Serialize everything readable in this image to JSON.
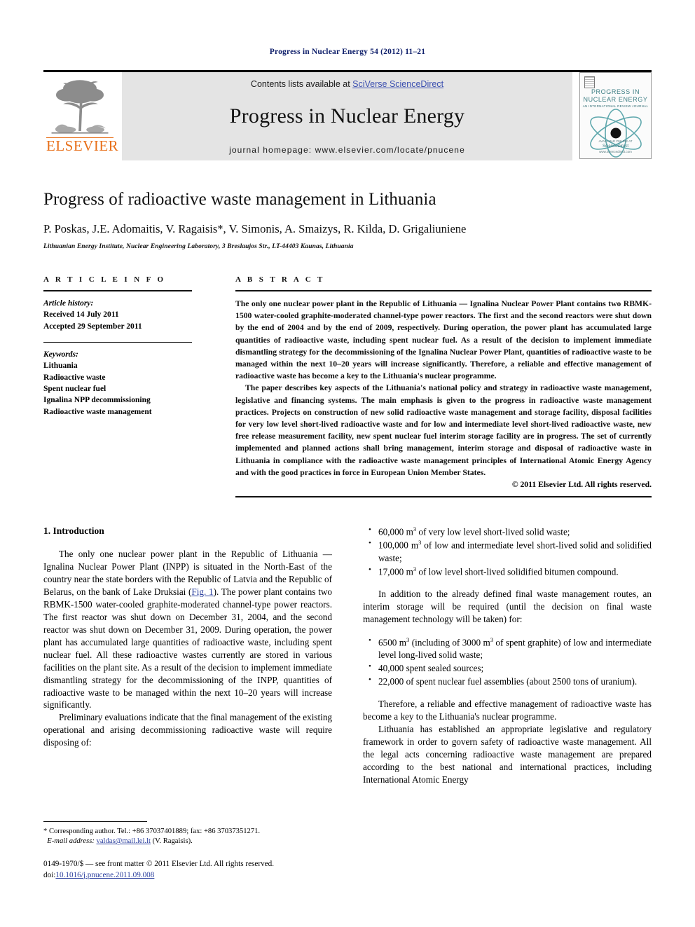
{
  "running_head": "Progress in Nuclear Energy 54 (2012) 11–21",
  "masthead": {
    "publisher_name": "ELSEVIER",
    "contents_prefix": "Contents lists available at ",
    "sciencedirect_link": "SciVerse ScienceDirect",
    "journal_title": "Progress in Nuclear Energy",
    "homepage_line": "journal homepage: www.elsevier.com/locate/pnucene",
    "cover": {
      "line1": "PROGRESS IN",
      "line2": "NUCLEAR ENERGY",
      "subtitle": "AN INTERNATIONAL REVIEW JOURNAL",
      "footer_small": "AVAILABLE ONLINE AT",
      "footer_big": "ScienceDirect",
      "footer_url": "www.sciencedirect.com"
    },
    "accent_orange": "#e8701a",
    "link_blue": "#3b4fb0",
    "band_gray": "#e4e4e4",
    "cover_teal": "#3f7f85"
  },
  "article": {
    "title": "Progress of radioactive waste management in Lithuania",
    "authors": "P. Poskas, J.E. Adomaitis, V. Ragaisis*, V. Simonis, A. Smaizys, R. Kilda, D. Grigaliuniene",
    "affiliation": "Lithuanian Energy Institute, Nuclear Engineering Laboratory, 3 Breslaujos Str., LT-44403 Kaunas, Lithuania"
  },
  "article_info": {
    "heading": "A R T I C L E   I N F O",
    "history_label": "Article history:",
    "received": "Received 14 July 2011",
    "accepted": "Accepted 29 September 2011",
    "keywords_label": "Keywords:",
    "keywords": [
      "Lithuania",
      "Radioactive waste",
      "Spent nuclear fuel",
      "Ignalina NPP decommissioning",
      "Radioactive waste management"
    ]
  },
  "abstract": {
    "heading": "A B S T R A C T",
    "paragraph1": "The only one nuclear power plant in the Republic of Lithuania — Ignalina Nuclear Power Plant contains two RBMK-1500 water-cooled graphite-moderated channel-type power reactors. The first and the second reactors were shut down by the end of 2004 and by the end of 2009, respectively. During operation, the power plant has accumulated large quantities of radioactive waste, including spent nuclear fuel. As a result of the decision to implement immediate dismantling strategy for the decommissioning of the Ignalina Nuclear Power Plant, quantities of radioactive waste to be managed within the next 10–20 years will increase significantly. Therefore, a reliable and effective management of radioactive waste has become a key to the Lithuania's nuclear programme.",
    "paragraph2": "The paper describes key aspects of the Lithuania's national policy and strategy in radioactive waste management, legislative and financing systems. The main emphasis is given to the progress in radioactive waste management practices. Projects on construction of new solid radioactive waste management and storage facility, disposal facilities for very low level short-lived radioactive waste and for low and intermediate level short-lived radioactive waste, new free release measurement facility, new spent nuclear fuel interim storage facility are in progress. The set of currently implemented and planned actions shall bring management, interim storage and disposal of radioactive waste in Lithuania in compliance with the radioactive waste management principles of International Atomic Energy Agency and with the good practices in force in European Union Member States.",
    "copyright": "© 2011 Elsevier Ltd. All rights reserved."
  },
  "body": {
    "section_number_title": "1. Introduction",
    "left_para1_a": "The only one nuclear power plant in the Republic of Lithuania — Ignalina Nuclear Power Plant (INPP) is situated in the North-East of the country near the state borders with the Republic of Latvia and the Republic of Belarus, on the bank of Lake Druksiai (",
    "fig_link": "Fig. 1",
    "left_para1_b": "). The power plant contains two RBMK-1500 water-cooled graphite-moderated channel-type power reactors. The first reactor was shut down on December 31, 2004, and the second reactor was shut down on December 31, 2009. During operation, the power plant has accumulated large quantities of radioactive waste, including spent nuclear fuel. All these radioactive wastes currently are stored in various facilities on the plant site. As a result of the decision to implement immediate dismantling strategy for the decommissioning of the INPP, quantities of radioactive waste to be managed within the next 10–20 years will increase significantly.",
    "left_para2": "Preliminary evaluations indicate that the final management of the existing operational and arising decommissioning radioactive waste will require disposing of:",
    "bullets_disposal": [
      {
        "amount": "60,000 m",
        "sup": "3",
        "rest": " of very low level short-lived solid waste;"
      },
      {
        "amount": "100,000 m",
        "sup": "3",
        "rest": " of low and intermediate level short-lived solid and solidified waste;"
      },
      {
        "amount": "17,000 m",
        "sup": "3",
        "rest": " of low level short-lived solidified bitumen compound."
      }
    ],
    "right_para1": "In addition to the already defined final waste management routes, an interim storage will be required (until the decision on final waste management technology will be taken) for:",
    "bullets_storage": [
      {
        "amount": "6500 m",
        "sup": "3",
        "rest": " (including of 3000 m",
        "sup2": "3",
        "rest2": " of spent graphite) of low and intermediate level long-lived solid waste;"
      },
      {
        "amount": "40,000 spent sealed sources;",
        "sup": "",
        "rest": ""
      },
      {
        "amount": "22,000 of spent nuclear fuel assemblies (about 2500 tons of uranium).",
        "sup": "",
        "rest": ""
      }
    ],
    "right_para2": "Therefore, a reliable and effective management of radioactive waste has become a key to the Lithuania's nuclear programme.",
    "right_para3": "Lithuania has established an appropriate legislative and regulatory framework in order to govern safety of radioactive waste management. All the legal acts concerning radioactive waste management are prepared according to the best national and international practices, including International Atomic Energy"
  },
  "footnotes": {
    "corresponding": "* Corresponding author. Tel.: +86 37037401889; fax: +86 37037351271.",
    "email_label": "E-mail address:",
    "email": "valdas@mail.lei.lt",
    "email_author": "(V. Ragaisis).",
    "issn_line": "0149-1970/$ — see front matter © 2011 Elsevier Ltd. All rights reserved.",
    "doi_label": "doi:",
    "doi_value": "10.1016/j.pnucene.2011.09.008"
  }
}
